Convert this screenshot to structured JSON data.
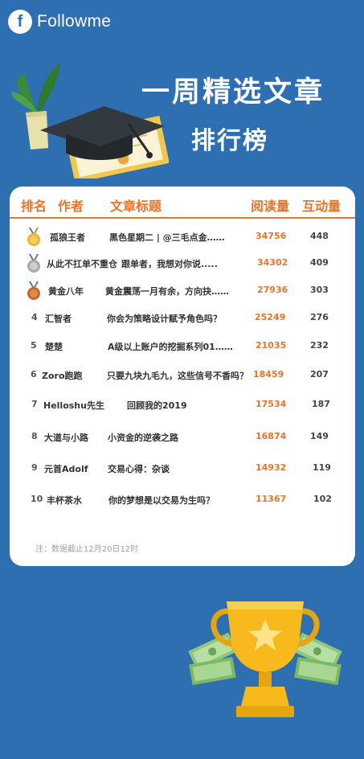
{
  "brand": {
    "logo_letter": "f",
    "name": "Followme"
  },
  "header": {
    "title_line1": "一周精选文章",
    "title_line2": "排行榜"
  },
  "table": {
    "columns": {
      "rank": "排名",
      "author": "作者",
      "title": "文章标题",
      "reads": "阅读量",
      "interactions": "互动量"
    },
    "rows": [
      {
        "rank": "1",
        "medal": "gold",
        "author": "孤狼王者",
        "title": "黑色星期二 | @三毛点金……",
        "reads": "34756",
        "interactions": "448"
      },
      {
        "rank": "2",
        "medal": "silver",
        "author": "从此不扛单不重仓",
        "title": "跟单者，我想对你说.....",
        "reads": "34302",
        "interactions": "409"
      },
      {
        "rank": "3",
        "medal": "bronze",
        "author": "黄金八年",
        "title": "黄金震荡一月有余，方向抉……",
        "reads": "27936",
        "interactions": "303"
      },
      {
        "rank": "4",
        "medal": "",
        "author": "汇智者",
        "title": "你会为策略设计赋予角色吗？",
        "reads": "25249",
        "interactions": "276"
      },
      {
        "rank": "5",
        "medal": "",
        "author": "楚楚",
        "title": "A级以上账户的挖掘系列01……",
        "reads": "21035",
        "interactions": "232"
      },
      {
        "rank": "6",
        "medal": "",
        "author": "Zoro跑跑",
        "title": "只要九块九毛九，这些信号不香吗？",
        "reads": "18459",
        "interactions": "207"
      },
      {
        "rank": "7",
        "medal": "",
        "author": "Helloshu先生",
        "title": "回顾我的2019",
        "reads": "17534",
        "interactions": "187"
      },
      {
        "rank": "8",
        "medal": "",
        "author": "大道与小路",
        "title": "小资金的逆袭之路",
        "reads": "16874",
        "interactions": "149"
      },
      {
        "rank": "9",
        "medal": "",
        "author": "元首Adolf",
        "title": "交易心得：杂谈",
        "reads": "14932",
        "interactions": "119"
      },
      {
        "rank": "10",
        "medal": "",
        "author": "丰杯茶水",
        "title": "你的梦想是以交易为生吗？",
        "reads": "11367",
        "interactions": "102"
      }
    ],
    "note": "注：数据截止12月20日12时"
  },
  "colors": {
    "background": "#2e6fb2",
    "accent": "#e8742a",
    "card": "#ffffff"
  }
}
